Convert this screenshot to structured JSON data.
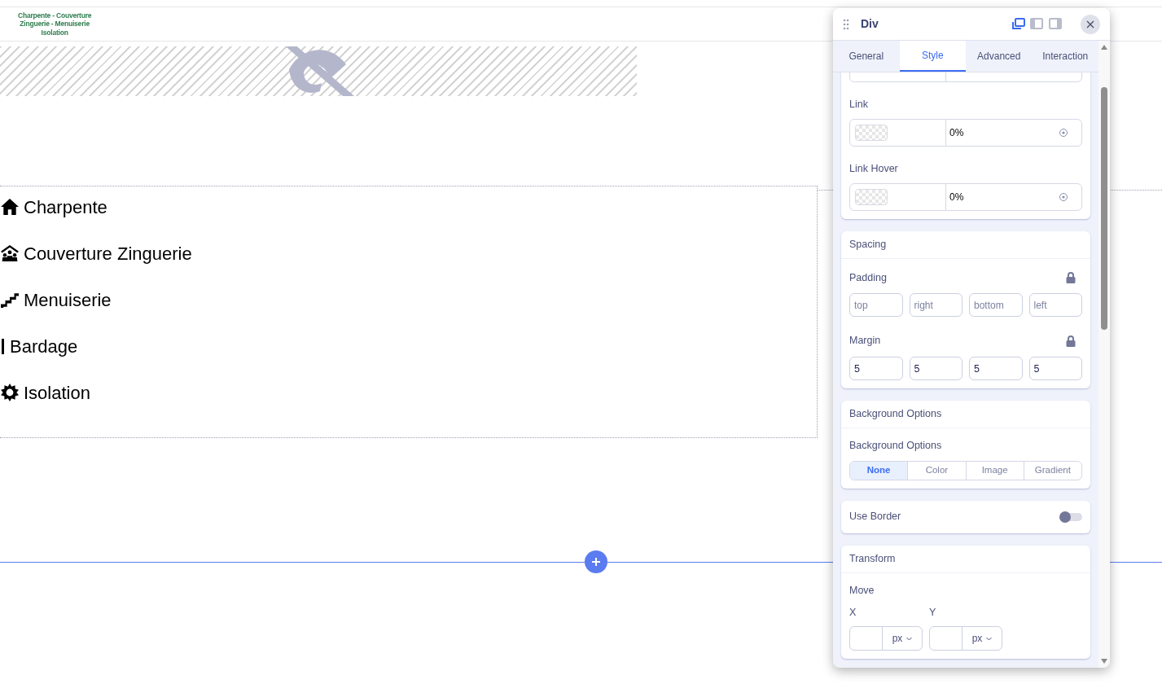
{
  "logo": {
    "lines": [
      "Charpente - Couverture",
      "Zinguerie - Menuiserie",
      "Isolation"
    ]
  },
  "menu": [
    {
      "kind": "house",
      "label": "Charpente"
    },
    {
      "kind": "people-roof",
      "label": "Couverture Zinguerie"
    },
    {
      "kind": "stairs",
      "label": "Menuiserie"
    },
    {
      "kind": "bar",
      "label": "Bardage"
    },
    {
      "kind": "sun",
      "label": "Isolation"
    }
  ],
  "panel": {
    "title": "Div",
    "layouts": [
      {
        "selected": true
      },
      {
        "selected": false
      },
      {
        "selected": false
      }
    ],
    "tabs": [
      {
        "label": "General",
        "selected": false
      },
      {
        "label": "Style",
        "selected": true
      },
      {
        "label": "Advanced",
        "selected": false
      },
      {
        "label": "Interaction",
        "selected": false
      }
    ],
    "colors": [
      {
        "label": "Link",
        "value": "0%"
      },
      {
        "label": "Link Hover",
        "value": "0%"
      }
    ],
    "spacing": {
      "title": "Spacing",
      "padding": {
        "label": "Padding",
        "placeholders": [
          "top",
          "right",
          "bottom",
          "left"
        ]
      },
      "margin": {
        "label": "Margin",
        "values": [
          "5",
          "5",
          "5",
          "5"
        ]
      }
    },
    "background": {
      "title": "Background Options",
      "label": "Background Options",
      "options": [
        {
          "label": "None",
          "selected": true
        },
        {
          "label": "Color",
          "selected": false
        },
        {
          "label": "Image",
          "selected": false
        },
        {
          "label": "Gradient",
          "selected": false
        }
      ]
    },
    "border": {
      "label": "Use Border",
      "on": false
    },
    "transform": {
      "title": "Transform",
      "move": "Move",
      "axes": [
        {
          "label": "X",
          "unit": "px"
        },
        {
          "label": "Y",
          "unit": "px"
        }
      ]
    }
  }
}
